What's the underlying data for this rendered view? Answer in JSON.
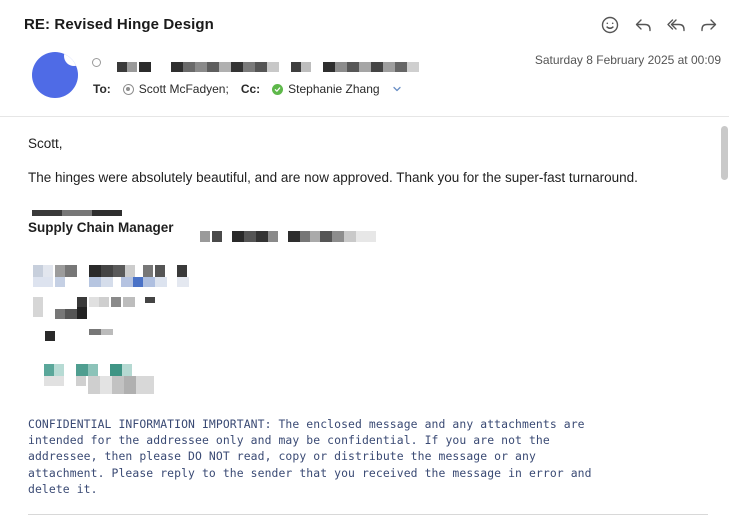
{
  "email": {
    "subject": "RE: Revised Hinge Design",
    "date": "Saturday 8 February 2025 at 00:09",
    "to_label": "To:",
    "to_name": "Scott McFadyen;",
    "cc_label": "Cc:",
    "cc_name": "Stephanie Zhang",
    "greeting": "Scott,",
    "message": "The hinges were absolutely beautiful, and are now approved. Thank you for the super-fast turnaround.",
    "signature_title": "Supply Chain Manager",
    "confidential_lines": [
      "CONFIDENTIAL INFORMATION IMPORTANT: The enclosed message and any attachments are",
      "intended for the addressee only and may be confidential. If you are not the",
      "addressee, then please DO NOT read, copy or distribute the message or any",
      "attachment. Please reply to the sender that you received the message in error and",
      "delete it."
    ]
  },
  "toolbar": {
    "icons": [
      "emoji-reaction-icon",
      "reply-icon",
      "reply-all-icon",
      "forward-icon"
    ]
  },
  "colors": {
    "avatar": "#4f6be6",
    "confidential_text": "#3a4a74",
    "online_status": "#5eb84a"
  }
}
